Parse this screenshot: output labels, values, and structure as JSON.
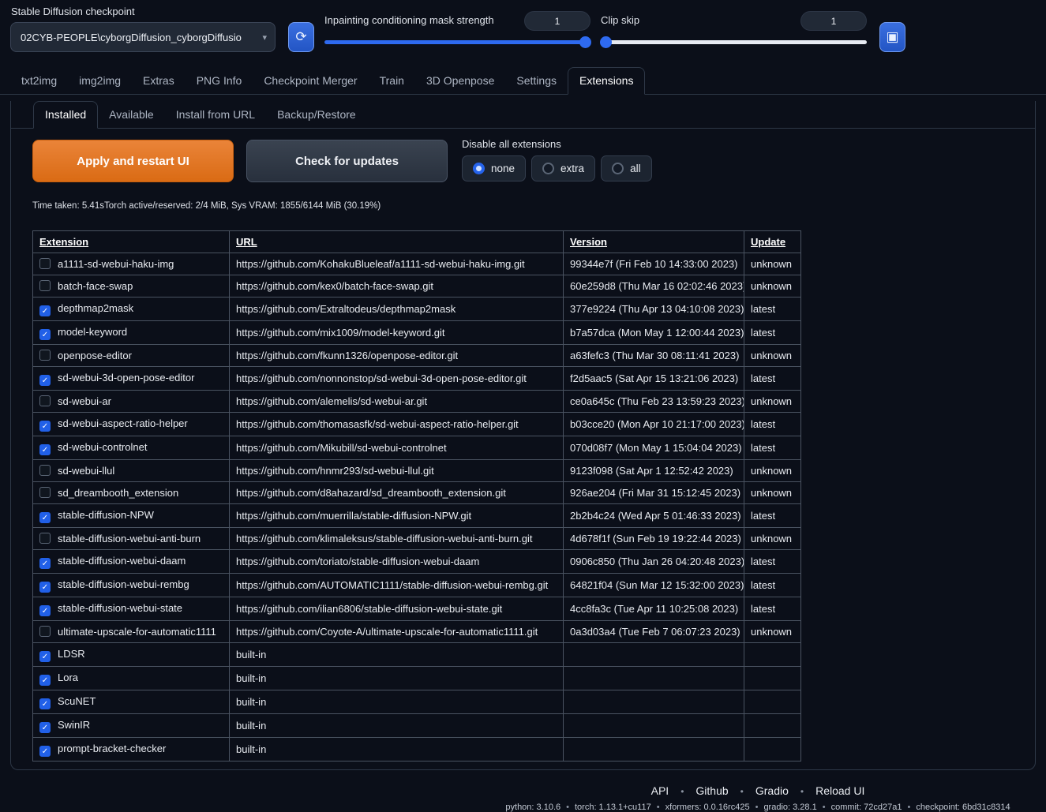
{
  "quicksettings": {
    "checkpoint": {
      "label": "Stable Diffusion checkpoint",
      "value": "02CYB-PEOPLE\\cyborgDiffusion_cyborgDiffusio"
    },
    "mask_strength": {
      "label": "Inpainting conditioning mask strength",
      "value": "1"
    },
    "clip_skip": {
      "label": "Clip skip",
      "value": "1"
    }
  },
  "icons": {
    "caret": "▾",
    "refresh": "⟳",
    "tool": "▣",
    "check": "✓",
    "bullet": "•"
  },
  "colors": {
    "accent_blue": "#2e6af0",
    "primary_orange": "#da6b14",
    "border": "#2e3847",
    "table_border": "#4a5361"
  },
  "tabs": [
    {
      "label": "txt2img",
      "active": false
    },
    {
      "label": "img2img",
      "active": false
    },
    {
      "label": "Extras",
      "active": false
    },
    {
      "label": "PNG Info",
      "active": false
    },
    {
      "label": "Checkpoint Merger",
      "active": false
    },
    {
      "label": "Train",
      "active": false
    },
    {
      "label": "3D Openpose",
      "active": false
    },
    {
      "label": "Settings",
      "active": false
    },
    {
      "label": "Extensions",
      "active": true
    }
  ],
  "subtabs": [
    {
      "label": "Installed",
      "active": true
    },
    {
      "label": "Available",
      "active": false
    },
    {
      "label": "Install from URL",
      "active": false
    },
    {
      "label": "Backup/Restore",
      "active": false
    }
  ],
  "actions": {
    "apply_label": "Apply and restart UI",
    "check_label": "Check for updates"
  },
  "disable_all": {
    "label": "Disable all extensions",
    "options": [
      "none",
      "extra",
      "all"
    ],
    "selected": "none"
  },
  "status": "Time taken: 5.41sTorch active/reserved: 2/4 MiB, Sys VRAM: 1855/6144 MiB (30.19%)",
  "table": {
    "headers": [
      "Extension",
      "URL",
      "Version",
      "Update"
    ],
    "rows": [
      {
        "checked": false,
        "name": "a1111-sd-webui-haku-img",
        "url": "https://github.com/KohakuBlueleaf/a1111-sd-webui-haku-img.git",
        "version": "99344e7f (Fri Feb 10 14:33:00 2023)",
        "update": "unknown"
      },
      {
        "checked": false,
        "name": "batch-face-swap",
        "url": "https://github.com/kex0/batch-face-swap.git",
        "version": "60e259d8 (Thu Mar 16 02:02:46 2023)",
        "update": "unknown"
      },
      {
        "checked": true,
        "name": "depthmap2mask",
        "url": "https://github.com/Extraltodeus/depthmap2mask",
        "version": "377e9224 (Thu Apr 13 04:10:08 2023)",
        "update": "latest"
      },
      {
        "checked": true,
        "name": "model-keyword",
        "url": "https://github.com/mix1009/model-keyword.git",
        "version": "b7a57dca (Mon May 1 12:00:44 2023)",
        "update": "latest"
      },
      {
        "checked": false,
        "name": "openpose-editor",
        "url": "https://github.com/fkunn1326/openpose-editor.git",
        "version": "a63fefc3 (Thu Mar 30 08:11:41 2023)",
        "update": "unknown"
      },
      {
        "checked": true,
        "name": "sd-webui-3d-open-pose-editor",
        "url": "https://github.com/nonnonstop/sd-webui-3d-open-pose-editor.git",
        "version": "f2d5aac5 (Sat Apr 15 13:21:06 2023)",
        "update": "latest"
      },
      {
        "checked": false,
        "name": "sd-webui-ar",
        "url": "https://github.com/alemelis/sd-webui-ar.git",
        "version": "ce0a645c (Thu Feb 23 13:59:23 2023)",
        "update": "unknown"
      },
      {
        "checked": true,
        "name": "sd-webui-aspect-ratio-helper",
        "url": "https://github.com/thomasasfk/sd-webui-aspect-ratio-helper.git",
        "version": "b03cce20 (Mon Apr 10 21:17:00 2023)",
        "update": "latest"
      },
      {
        "checked": true,
        "name": "sd-webui-controlnet",
        "url": "https://github.com/Mikubill/sd-webui-controlnet",
        "version": "070d08f7 (Mon May 1 15:04:04 2023)",
        "update": "latest"
      },
      {
        "checked": false,
        "name": "sd-webui-llul",
        "url": "https://github.com/hnmr293/sd-webui-llul.git",
        "version": "9123f098 (Sat Apr 1 12:52:42 2023)",
        "update": "unknown"
      },
      {
        "checked": false,
        "name": "sd_dreambooth_extension",
        "url": "https://github.com/d8ahazard/sd_dreambooth_extension.git",
        "version": "926ae204 (Fri Mar 31 15:12:45 2023)",
        "update": "unknown"
      },
      {
        "checked": true,
        "name": "stable-diffusion-NPW",
        "url": "https://github.com/muerrilla/stable-diffusion-NPW.git",
        "version": "2b2b4c24 (Wed Apr 5 01:46:33 2023)",
        "update": "latest"
      },
      {
        "checked": false,
        "name": "stable-diffusion-webui-anti-burn",
        "url": "https://github.com/klimaleksus/stable-diffusion-webui-anti-burn.git",
        "version": "4d678f1f (Sun Feb 19 19:22:44 2023)",
        "update": "unknown"
      },
      {
        "checked": true,
        "name": "stable-diffusion-webui-daam",
        "url": "https://github.com/toriato/stable-diffusion-webui-daam",
        "version": "0906c850 (Thu Jan 26 04:20:48 2023)",
        "update": "latest"
      },
      {
        "checked": true,
        "name": "stable-diffusion-webui-rembg",
        "url": "https://github.com/AUTOMATIC1111/stable-diffusion-webui-rembg.git",
        "version": "64821f04 (Sun Mar 12 15:32:00 2023)",
        "update": "latest"
      },
      {
        "checked": true,
        "name": "stable-diffusion-webui-state",
        "url": "https://github.com/ilian6806/stable-diffusion-webui-state.git",
        "version": "4cc8fa3c (Tue Apr 11 10:25:08 2023)",
        "update": "latest"
      },
      {
        "checked": false,
        "name": "ultimate-upscale-for-automatic1111",
        "url": "https://github.com/Coyote-A/ultimate-upscale-for-automatic1111.git",
        "version": "0a3d03a4 (Tue Feb 7 06:07:23 2023)",
        "update": "unknown"
      },
      {
        "checked": true,
        "name": "LDSR",
        "url": "built-in",
        "version": "",
        "update": ""
      },
      {
        "checked": true,
        "name": "Lora",
        "url": "built-in",
        "version": "",
        "update": ""
      },
      {
        "checked": true,
        "name": "ScuNET",
        "url": "built-in",
        "version": "",
        "update": ""
      },
      {
        "checked": true,
        "name": "SwinIR",
        "url": "built-in",
        "version": "",
        "update": ""
      },
      {
        "checked": true,
        "name": "prompt-bracket-checker",
        "url": "built-in",
        "version": "",
        "update": ""
      }
    ]
  },
  "footer": {
    "links": [
      "API",
      "Github",
      "Gradio",
      "Reload UI"
    ],
    "info": [
      "python: 3.10.6",
      "torch: 1.13.1+cu117",
      "xformers: 0.0.16rc425",
      "gradio: 3.28.1",
      "commit: 72cd27a1",
      "checkpoint: 6bd31c8314"
    ]
  }
}
